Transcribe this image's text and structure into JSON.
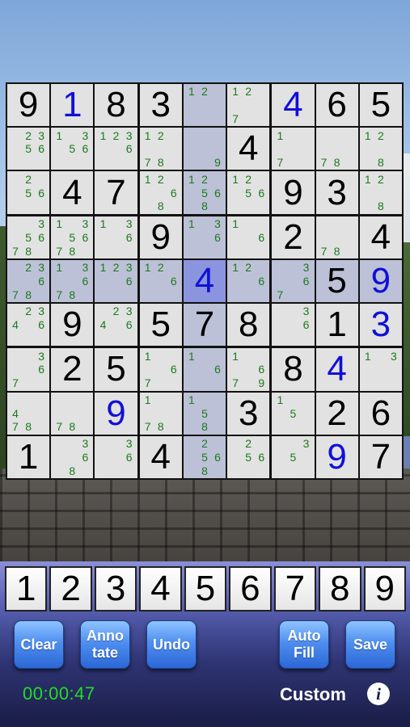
{
  "grid": {
    "cells": [
      [
        {
          "v": "9"
        },
        {
          "v": "1",
          "c": "blue"
        },
        {
          "v": "8"
        },
        {
          "v": "3"
        },
        {
          "n": [
            "1",
            "2",
            "",
            "",
            "",
            "",
            "",
            "",
            ""
          ],
          "h": true
        },
        {
          "n": [
            "1",
            "2",
            "",
            "",
            "",
            "",
            "7",
            "",
            ""
          ]
        },
        {
          "v": "4",
          "c": "blue"
        },
        {
          "v": "6"
        },
        {
          "v": "5"
        }
      ],
      [
        {
          "n": [
            "",
            "2",
            "3",
            "",
            "5",
            "6",
            "",
            "",
            ""
          ]
        },
        {
          "n": [
            "1",
            "",
            "3",
            "",
            "5",
            "6",
            "",
            "",
            ""
          ]
        },
        {
          "n": [
            "1",
            "2",
            "3",
            "",
            "",
            "6",
            "",
            "",
            ""
          ]
        },
        {
          "n": [
            "1",
            "2",
            "",
            "",
            "",
            "",
            "7",
            "8",
            ""
          ]
        },
        {
          "n": [
            "",
            "",
            "",
            "",
            "",
            "",
            "",
            "",
            "9"
          ],
          "h": true
        },
        {
          "v": "4"
        },
        {
          "n": [
            "1",
            "",
            "",
            "",
            "",
            "",
            "7",
            "",
            ""
          ]
        },
        {
          "n": [
            "",
            "",
            "",
            "",
            "",
            "",
            "7",
            "8",
            ""
          ]
        },
        {
          "n": [
            "1",
            "2",
            "",
            "",
            "",
            "",
            "",
            "8",
            ""
          ]
        }
      ],
      [
        {
          "n": [
            "",
            "2",
            "",
            "",
            "5",
            "6",
            "",
            "",
            ""
          ]
        },
        {
          "v": "4"
        },
        {
          "v": "7"
        },
        {
          "n": [
            "1",
            "2",
            "",
            "",
            "",
            "6",
            "",
            "8",
            ""
          ]
        },
        {
          "n": [
            "1",
            "2",
            "",
            "",
            "5",
            "6",
            "",
            "8",
            ""
          ],
          "h": true
        },
        {
          "n": [
            "1",
            "2",
            "",
            "",
            "5",
            "6",
            "",
            "",
            ""
          ]
        },
        {
          "v": "9"
        },
        {
          "v": "3"
        },
        {
          "n": [
            "1",
            "2",
            "",
            "",
            "",
            "",
            "",
            "8",
            ""
          ]
        }
      ],
      [
        {
          "n": [
            "",
            "",
            "3",
            "",
            "5",
            "6",
            "7",
            "8",
            ""
          ]
        },
        {
          "n": [
            "1",
            "",
            "3",
            "",
            "5",
            "6",
            "7",
            "8",
            ""
          ]
        },
        {
          "n": [
            "1",
            "",
            "3",
            "",
            "",
            "6",
            "",
            "",
            ""
          ]
        },
        {
          "v": "9"
        },
        {
          "n": [
            "1",
            "",
            "3",
            "",
            "",
            "6",
            "",
            "",
            ""
          ],
          "h": true
        },
        {
          "n": [
            "1",
            "",
            "",
            "",
            "",
            "6",
            "",
            "",
            ""
          ]
        },
        {
          "v": "2"
        },
        {
          "n": [
            "",
            "",
            "",
            "",
            "",
            "",
            "7",
            "8",
            ""
          ]
        },
        {
          "v": "4"
        }
      ],
      [
        {
          "n": [
            "",
            "2",
            "3",
            "",
            "",
            "6",
            "7",
            "8",
            ""
          ],
          "h": true
        },
        {
          "n": [
            "1",
            "",
            "3",
            "",
            "",
            "6",
            "7",
            "8",
            ""
          ],
          "h": true
        },
        {
          "n": [
            "1",
            "2",
            "3",
            "",
            "",
            "6",
            "",
            "",
            ""
          ],
          "h": true
        },
        {
          "n": [
            "1",
            "2",
            "",
            "",
            "",
            "6",
            "",
            "",
            ""
          ],
          "h": true
        },
        {
          "v": "4",
          "c": "blue",
          "s": true
        },
        {
          "n": [
            "1",
            "2",
            "",
            "",
            "",
            "6",
            "",
            "",
            ""
          ],
          "h": true
        },
        {
          "n": [
            "",
            "",
            "3",
            "",
            "",
            "6",
            "7",
            "",
            ""
          ],
          "h": true
        },
        {
          "v": "5",
          "h": true
        },
        {
          "v": "9",
          "c": "blue",
          "h": true
        }
      ],
      [
        {
          "n": [
            "",
            "2",
            "3",
            "4",
            "",
            "6",
            "",
            "",
            ""
          ]
        },
        {
          "v": "9"
        },
        {
          "n": [
            "",
            "2",
            "3",
            "4",
            "",
            "6",
            "",
            "",
            ""
          ]
        },
        {
          "v": "5"
        },
        {
          "v": "7",
          "h": true
        },
        {
          "v": "8"
        },
        {
          "n": [
            "",
            "",
            "3",
            "",
            "",
            "6",
            "",
            "",
            ""
          ]
        },
        {
          "v": "1"
        },
        {
          "v": "3",
          "c": "blue"
        }
      ],
      [
        {
          "n": [
            "",
            "",
            "3",
            "",
            "",
            "6",
            "7",
            "",
            ""
          ]
        },
        {
          "v": "2"
        },
        {
          "v": "5"
        },
        {
          "n": [
            "1",
            "",
            "",
            "",
            "",
            "6",
            "7",
            "",
            ""
          ]
        },
        {
          "n": [
            "1",
            "",
            "",
            "",
            "",
            "6",
            "",
            "",
            ""
          ],
          "h": true
        },
        {
          "n": [
            "1",
            "",
            "",
            "",
            "",
            "6",
            "7",
            "",
            "9"
          ]
        },
        {
          "v": "8"
        },
        {
          "v": "4",
          "c": "blue"
        },
        {
          "n": [
            "1",
            "",
            "3",
            "",
            "",
            "",
            "",
            "",
            ""
          ]
        }
      ],
      [
        {
          "n": [
            "",
            "",
            "",
            "4",
            "",
            "",
            "7",
            "8",
            ""
          ]
        },
        {
          "n": [
            "",
            "",
            "",
            "",
            "",
            "",
            "7",
            "8",
            ""
          ]
        },
        {
          "v": "9",
          "c": "blue"
        },
        {
          "n": [
            "1",
            "",
            "",
            "",
            "",
            "",
            "7",
            "8",
            ""
          ]
        },
        {
          "n": [
            "1",
            "",
            "",
            "",
            "5",
            "",
            "",
            "8",
            ""
          ],
          "h": true
        },
        {
          "v": "3"
        },
        {
          "n": [
            "1",
            "",
            "",
            "",
            "5",
            "",
            "",
            "",
            ""
          ]
        },
        {
          "v": "2"
        },
        {
          "v": "6"
        }
      ],
      [
        {
          "v": "1"
        },
        {
          "n": [
            "",
            "",
            "3",
            "",
            "",
            "6",
            "",
            "8",
            ""
          ]
        },
        {
          "n": [
            "",
            "",
            "3",
            "",
            "",
            "6",
            "",
            "",
            ""
          ]
        },
        {
          "v": "4"
        },
        {
          "n": [
            "",
            "2",
            "",
            "",
            "5",
            "6",
            "",
            "8",
            ""
          ],
          "h": true
        },
        {
          "n": [
            "",
            "2",
            "",
            "",
            "5",
            "6",
            "",
            "",
            ""
          ]
        },
        {
          "n": [
            "",
            "",
            "3",
            "",
            "5",
            "",
            "",
            "",
            ""
          ]
        },
        {
          "v": "9",
          "c": "blue"
        },
        {
          "v": "7"
        }
      ]
    ]
  },
  "numpad": [
    "1",
    "2",
    "3",
    "4",
    "5",
    "6",
    "7",
    "8",
    "9"
  ],
  "buttons": {
    "clear": "Clear",
    "annotate": "Anno\ntate",
    "undo": "Undo",
    "autofill": "Auto\nFill",
    "save": "Save"
  },
  "status": {
    "timer": "00:00:47",
    "mode": "Custom",
    "info_icon": "i"
  },
  "colors": {
    "given_black": "#000000",
    "entered_blue": "#1010d8",
    "note_green": "#1c7a1c",
    "timer_green": "#22dd22",
    "button_blue": "#4f8ff0"
  }
}
